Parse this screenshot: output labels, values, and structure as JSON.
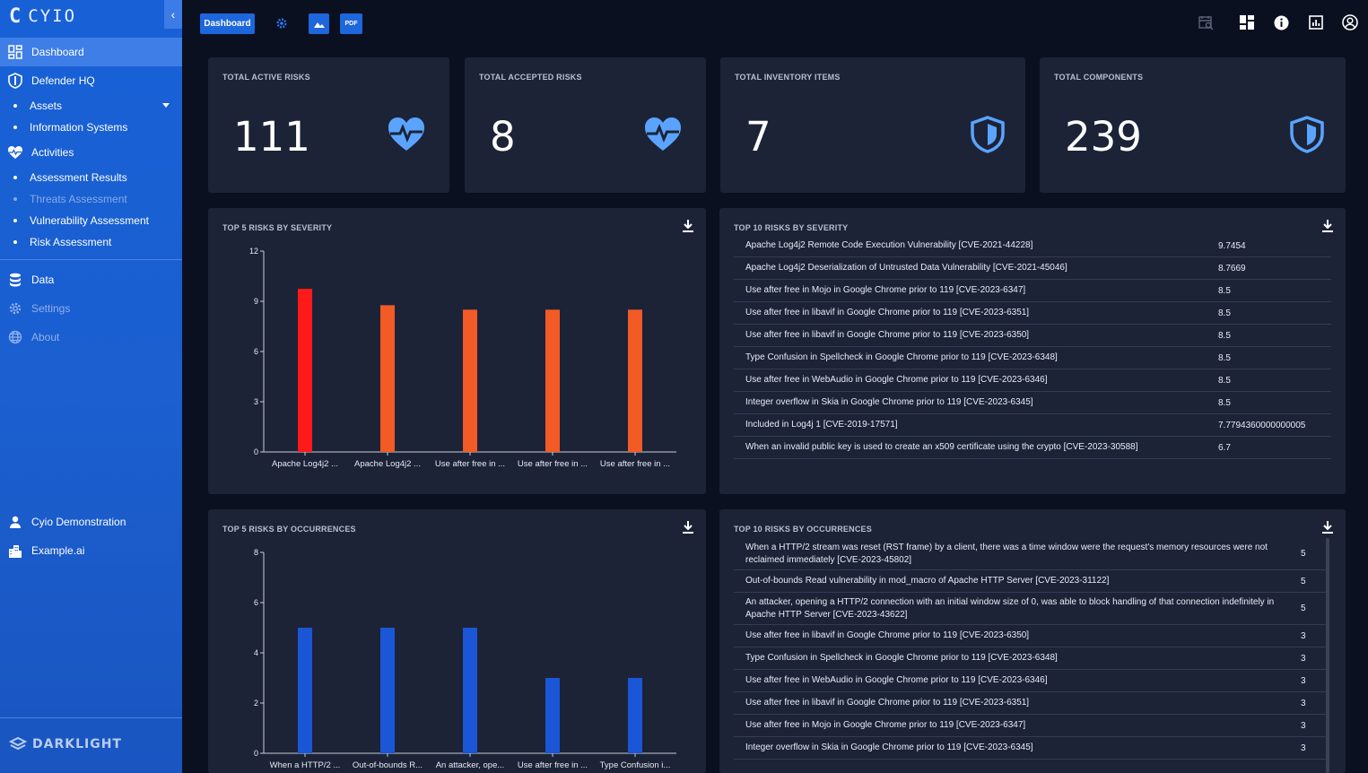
{
  "brand": {
    "name": "CYIO",
    "footer": "DARKLIGHT"
  },
  "sidebar": {
    "items": [
      {
        "label": "Dashboard"
      },
      {
        "label": "Defender HQ"
      },
      {
        "label": "Assets"
      },
      {
        "label": "Information Systems"
      },
      {
        "label": "Activities"
      },
      {
        "label": "Assessment Results"
      },
      {
        "label": "Threats Assessment"
      },
      {
        "label": "Vulnerability Assessment"
      },
      {
        "label": "Risk Assessment"
      },
      {
        "label": "Data"
      },
      {
        "label": "Settings"
      },
      {
        "label": "About"
      }
    ],
    "user": "Cyio Demonstration",
    "org": "Example.ai"
  },
  "topbar": {
    "dashboard_label": "Dashboard",
    "pdf_label": "PDF"
  },
  "stats": [
    {
      "title": "TOTAL ACTIVE RISKS",
      "value": "111",
      "icon": "heart-pulse-icon"
    },
    {
      "title": "TOTAL ACCEPTED RISKS",
      "value": "8",
      "icon": "heart-pulse-icon"
    },
    {
      "title": "TOTAL INVENTORY ITEMS",
      "value": "7",
      "icon": "shield-icon"
    },
    {
      "title": "TOTAL COMPONENTS",
      "value": "239",
      "icon": "shield-icon"
    }
  ],
  "severity_chart_title": "TOP 5 RISKS BY SEVERITY",
  "occurrence_chart_title": "TOP 5 RISKS BY OCCURRENCES",
  "chart_data": [
    {
      "type": "bar",
      "title": "TOP 5 RISKS BY SEVERITY",
      "categories": [
        "Apache Log4j2 ...",
        "Apache Log4j2 ...",
        "Use after free in ...",
        "Use after free in ...",
        "Use after free in ..."
      ],
      "values": [
        9.7454,
        8.7669,
        8.5,
        8.5,
        8.5
      ],
      "colors": [
        "#ff1a1a",
        "#f25a26",
        "#f25a26",
        "#f25a26",
        "#f25a26"
      ],
      "ylim": [
        0,
        12
      ],
      "yticks": [
        0,
        3,
        6,
        9,
        12
      ]
    },
    {
      "type": "bar",
      "title": "TOP 5 RISKS BY OCCURRENCES",
      "categories": [
        "When a HTTP/2 ...",
        "Out-of-bounds R...",
        "An attacker, ope...",
        "Use after free in ...",
        "Type Confusion i..."
      ],
      "values": [
        5,
        5,
        5,
        3,
        3
      ],
      "colors": [
        "#1a56d6",
        "#1a56d6",
        "#1a56d6",
        "#1a56d6",
        "#1a56d6"
      ],
      "ylim": [
        0,
        8
      ],
      "yticks": [
        0,
        2,
        4,
        6,
        8
      ]
    }
  ],
  "top10_severity": {
    "title": "TOP 10 RISKS BY SEVERITY",
    "rows": [
      {
        "name": "Apache Log4j2 Remote Code Execution Vulnerability [CVE-2021-44228]",
        "score": "9.7454"
      },
      {
        "name": "Apache Log4j2 Deserialization of Untrusted Data Vulnerability [CVE-2021-45046]",
        "score": "8.7669"
      },
      {
        "name": "Use after free in Mojo in Google Chrome prior to 119 [CVE-2023-6347]",
        "score": "8.5"
      },
      {
        "name": "Use after free in libavif in Google Chrome prior to 119 [CVE-2023-6351]",
        "score": "8.5"
      },
      {
        "name": "Use after free in libavif in Google Chrome prior to 119 [CVE-2023-6350]",
        "score": "8.5"
      },
      {
        "name": "Type Confusion in Spellcheck in Google Chrome prior to 119 [CVE-2023-6348]",
        "score": "8.5"
      },
      {
        "name": "Use after free in WebAudio in Google Chrome prior to 119 [CVE-2023-6346]",
        "score": "8.5"
      },
      {
        "name": "Integer overflow in Skia in Google Chrome prior to 119 [CVE-2023-6345]",
        "score": "8.5"
      },
      {
        "name": "Included in Log4j 1 [CVE-2019-17571]",
        "score": "7.7794360000000005"
      },
      {
        "name": "When an invalid public key is used to create an x509 certificate using the crypto [CVE-2023-30588]",
        "score": "6.7"
      }
    ]
  },
  "top10_occurrences": {
    "title": "TOP 10 RISKS BY OCCURRENCES",
    "rows": [
      {
        "name": "When a HTTP/2 stream was reset (RST frame) by a client, there was a time window were the request's memory resources were not reclaimed immediately [CVE-2023-45802]",
        "count": "5"
      },
      {
        "name": "Out-of-bounds Read vulnerability in mod_macro of Apache HTTP Server [CVE-2023-31122]",
        "count": "5"
      },
      {
        "name": "An attacker, opening a HTTP/2 connection with an initial window size of 0, was able to block handling of that connection indefinitely in Apache HTTP Server [CVE-2023-43622]",
        "count": "5"
      },
      {
        "name": "Use after free in libavif in Google Chrome prior to 119 [CVE-2023-6350]",
        "count": "3"
      },
      {
        "name": "Type Confusion in Spellcheck in Google Chrome prior to 119 [CVE-2023-6348]",
        "count": "3"
      },
      {
        "name": "Use after free in WebAudio in Google Chrome prior to 119 [CVE-2023-6346]",
        "count": "3"
      },
      {
        "name": "Use after free in libavif in Google Chrome prior to 119 [CVE-2023-6351]",
        "count": "3"
      },
      {
        "name": "Use after free in Mojo in Google Chrome prior to 119 [CVE-2023-6347]",
        "count": "3"
      },
      {
        "name": "Integer overflow in Skia in Google Chrome prior to 119 [CVE-2023-6345]",
        "count": "3"
      }
    ]
  }
}
